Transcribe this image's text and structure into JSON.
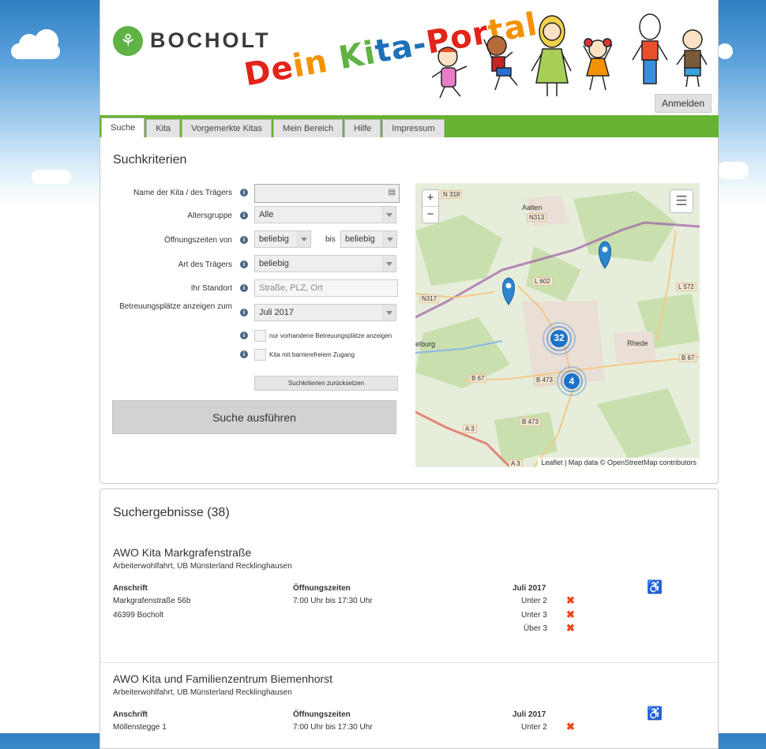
{
  "header": {
    "city_logo": "BOCHOLT",
    "portal_title": [
      "De",
      "in ",
      "Ki",
      "ta-",
      "Por",
      "tal"
    ],
    "login_label": "Anmelden"
  },
  "nav": {
    "tabs": [
      {
        "label": "Suche",
        "active": true
      },
      {
        "label": "Kita",
        "active": false
      },
      {
        "label": "Vorgemerkte Kitas",
        "active": false
      },
      {
        "label": "Mein Bereich",
        "active": false
      },
      {
        "label": "Hilfe",
        "active": false
      },
      {
        "label": "Impressum",
        "active": false
      }
    ]
  },
  "search": {
    "title": "Suchkriterien",
    "name_label": "Name der Kita / des Trägers",
    "name_value": "",
    "age_label": "Altersgruppe",
    "age_value": "Alle",
    "hours_label": "Öffnungszeiten von",
    "hours_from": "beliebig",
    "hours_bis": "bis",
    "hours_to": "beliebig",
    "type_label": "Art des Trägers",
    "type_value": "beliebig",
    "location_label": "Ihr Standort",
    "location_placeholder": "Straße, PLZ, Ort",
    "places_label": "Betreuungsplätze anzeigen zum",
    "places_value": "Juli 2017",
    "only_available_label": "nur vorhandene Betreuungsplätze anzeigen",
    "barrier_free_label": "Kita mit barrierefreiem Zugang",
    "reset_label": "Suchkriterien zurücksetzen",
    "submit_label": "Suche ausführen"
  },
  "map": {
    "zoom_in": "+",
    "zoom_out": "−",
    "attribution": "Leaflet | Map data © OpenStreetMap contributors",
    "labels": {
      "n318": "N 318",
      "aalten": "Aalten",
      "n313": "N313",
      "l602": "L 602",
      "n317": "N317",
      "l572": "L 572",
      "elburg": "elburg",
      "rhede": "Rhede",
      "b67a": "B 67",
      "b67b": "B 67",
      "b473a": "B 473",
      "b473b": "B 473",
      "a3a": "A 3",
      "a3b": "A 3"
    },
    "clusters": [
      "32",
      "4"
    ],
    "colors": {
      "cluster": "#1a72c9",
      "marker": "#2b86cf",
      "border": "#a05ca6"
    }
  },
  "results": {
    "title": "Suchergebnisse (38)",
    "col_address": "Anschrift",
    "col_hours": "Öffnungszeiten",
    "col_month": "Juli 2017",
    "items": [
      {
        "name": "AWO Kita Markgrafenstraße",
        "trager": "Arbeiterwohlfahrt, UB Münsterland Recklinghausen",
        "street": "Markgrafenstraße 56b",
        "city": "46399 Bocholt",
        "hours": "7:00 Uhr bis 17:30 Uhr",
        "groups": [
          "Unter 2",
          "Unter 3",
          "Über 3"
        ]
      },
      {
        "name": "AWO Kita und Familienzentrum Biemenhorst",
        "trager": "Arbeiterwohlfahrt, UB Münsterland Recklinghausen",
        "street": "Möllenstegge 1",
        "city": "",
        "hours": "7:00 Uhr bis 17:30 Uhr",
        "groups": [
          "Unter 2"
        ]
      }
    ]
  }
}
